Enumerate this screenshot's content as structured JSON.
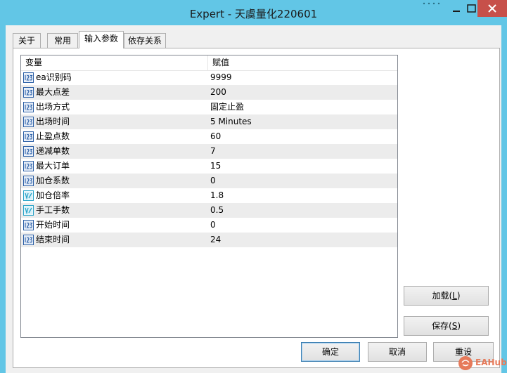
{
  "window": {
    "title": "Expert - 天虞量化220601"
  },
  "tabs": [
    {
      "label": "关于",
      "active": false
    },
    {
      "label": "常用",
      "active": false
    },
    {
      "label": "输入参数",
      "active": true
    },
    {
      "label": "依存关系",
      "active": false
    }
  ],
  "table": {
    "headers": [
      "变量",
      "赋值"
    ],
    "rows": [
      {
        "name": "ea识别码",
        "value": "9999",
        "icon": "int-icon"
      },
      {
        "name": "最大点差",
        "value": "200",
        "icon": "int-icon"
      },
      {
        "name": "出场方式",
        "value": "固定止盈",
        "icon": "int-icon"
      },
      {
        "name": "出场时间",
        "value": "5 Minutes",
        "icon": "int-icon"
      },
      {
        "name": "止盈点数",
        "value": "60",
        "icon": "int-icon"
      },
      {
        "name": "递减单数",
        "value": "7",
        "icon": "int-icon"
      },
      {
        "name": "最大订单",
        "value": "15",
        "icon": "int-icon"
      },
      {
        "name": "加仓系数",
        "value": "0",
        "icon": "int-icon"
      },
      {
        "name": "加仓倍率",
        "value": "1.8",
        "icon": "double-icon"
      },
      {
        "name": "手工手数",
        "value": "0.5",
        "icon": "double-icon"
      },
      {
        "name": "开始时间",
        "value": "0",
        "icon": "int-icon"
      },
      {
        "name": "结束时间",
        "value": "24",
        "icon": "int-icon"
      }
    ]
  },
  "buttons": {
    "load": "加载(L)",
    "save": "保存(S)",
    "ok": "确定",
    "cancel": "取消",
    "reset": "重设"
  },
  "watermark": {
    "text": "EAHub"
  },
  "colors": {
    "titlebar": "#62c6e6",
    "close": "#c7504a",
    "row_alt": "#ececec",
    "int_icon": "#2b5fa6",
    "double_icon": "#2aa3c8"
  }
}
